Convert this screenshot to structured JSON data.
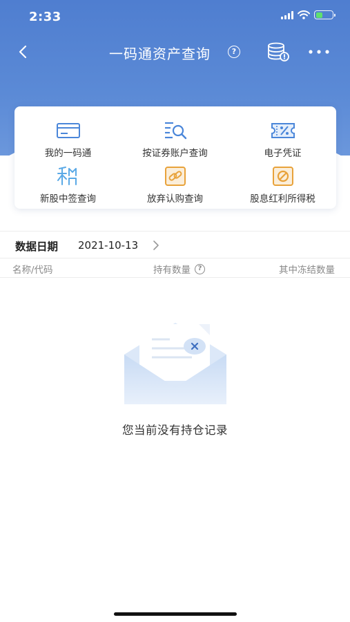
{
  "status": {
    "time": "2:33"
  },
  "nav": {
    "title": "一码通资产查询",
    "help_glyph": "?"
  },
  "colors": {
    "primary": "#5584d4",
    "icon_blue": "#4a86d9",
    "icon_orange": "#e8a23a",
    "text": "#333333",
    "muted": "#8a8a8a"
  },
  "shortcuts": [
    {
      "label": "我的一码通",
      "icon": "card-icon"
    },
    {
      "label": "按证券账户查询",
      "icon": "list-search-icon"
    },
    {
      "label": "电子凭证",
      "icon": "voucher-percent-icon"
    },
    {
      "label": "新股中签查询",
      "icon": "lottery-chars-icon"
    },
    {
      "label": "放弃认购查询",
      "icon": "link-abandon-icon"
    },
    {
      "label": "股息红利所得税",
      "icon": "tax-ban-icon"
    }
  ],
  "date": {
    "label": "数据日期",
    "value": "2021-10-13"
  },
  "table": {
    "col_name": "名称/代码",
    "col_qty": "持有数量",
    "col_frozen": "其中冻结数量",
    "help_glyph": "?"
  },
  "empty": {
    "message": "您当前没有持仓记录"
  }
}
